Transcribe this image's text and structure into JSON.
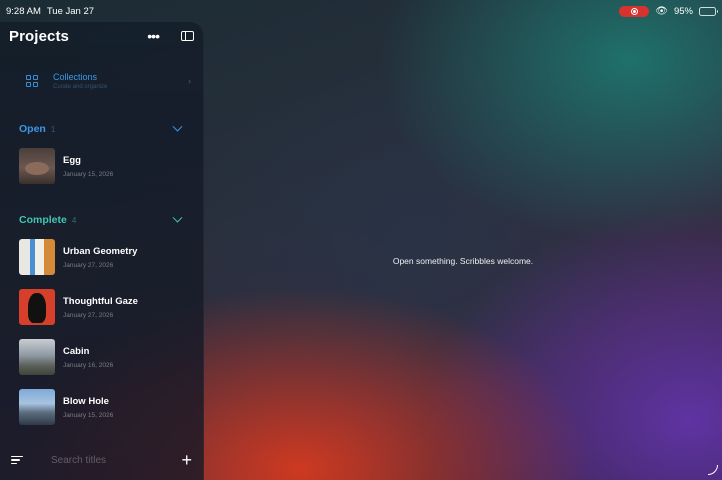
{
  "status_bar": {
    "time": "9:28 AM",
    "date": "Tue Jan 27",
    "battery": "95%",
    "battery_level": 0.95,
    "record_color": "#d8322e"
  },
  "sidebar": {
    "title": "Projects",
    "more_icon": "ellipsis-icon",
    "toggle_icon": "sidebar-toggle-icon",
    "collections": {
      "label": "Collections",
      "subtitle": "Curate and organize",
      "icon": "grid-icon"
    },
    "sections": {
      "open": {
        "title": "Open",
        "count": "1",
        "color": "#3c98e6",
        "items": [
          {
            "title": "Egg",
            "date": "January 15, 2026"
          }
        ]
      },
      "complete": {
        "title": "Complete",
        "count": "4",
        "color": "#3fc7b0",
        "items": [
          {
            "title": "Urban Geometry",
            "date": "January 27, 2026"
          },
          {
            "title": "Thoughtful Gaze",
            "date": "January 27, 2026"
          },
          {
            "title": "Cabin",
            "date": "January 16, 2026"
          },
          {
            "title": "Blow Hole",
            "date": "January 15, 2026"
          }
        ]
      }
    },
    "search": {
      "placeholder": "Search titles"
    },
    "menu_icon": "menu-icon",
    "add_icon": "plus-icon"
  },
  "main": {
    "empty_message": "Open something. Scribbles welcome."
  }
}
